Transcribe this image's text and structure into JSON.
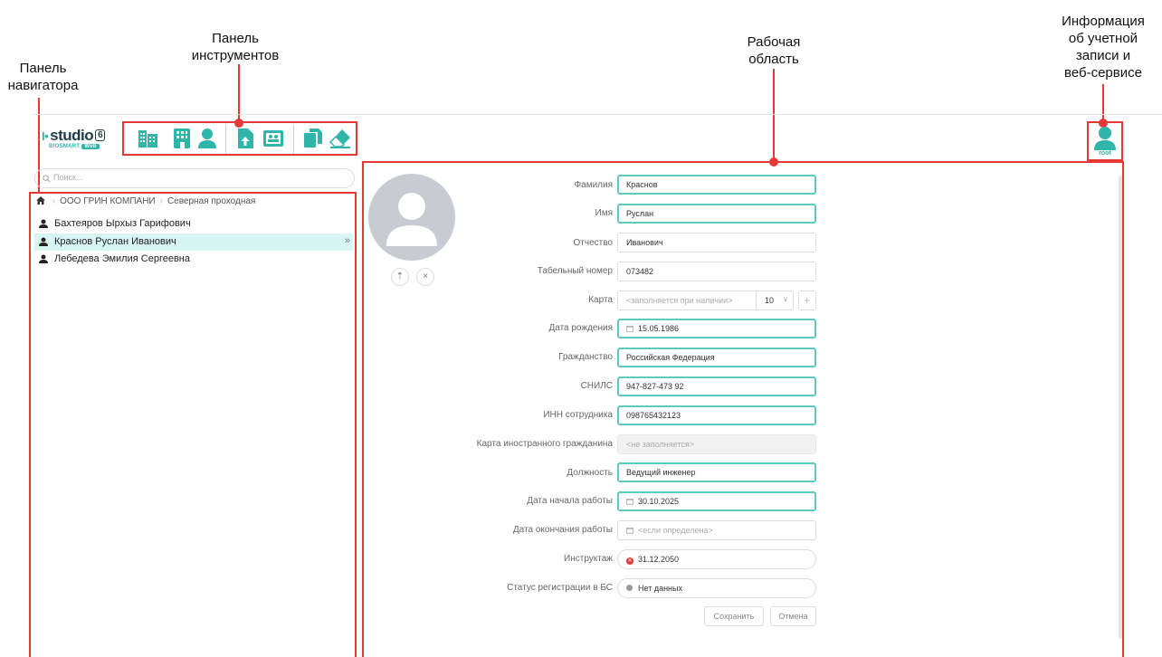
{
  "annotations": {
    "navigator_line1": "Панель",
    "navigator_line2": "навигатора",
    "toolbar_line1": "Панель",
    "toolbar_line2": "инструментов",
    "workspace_line1": "Рабочая",
    "workspace_line2": "область",
    "account_line1": "Информация",
    "account_line2": "об учетной",
    "account_line3": "записи и",
    "account_line4": "веб-сервисе"
  },
  "app": {
    "logo_text": "studio",
    "logo_version": "6",
    "logo_sub": "BIOSMART",
    "logo_web": "Web"
  },
  "toolbar": {
    "icons": [
      "organization-icon",
      "building-icon",
      "person-icon",
      "upload-file-icon",
      "badge-icon",
      "copy-icon",
      "eraser-icon"
    ]
  },
  "account": {
    "user": "root"
  },
  "navigator": {
    "search_placeholder": "Поиск...",
    "breadcrumb": [
      "ООО ГРИН КОМПАНИ",
      "Северная проходная"
    ],
    "people": [
      {
        "name": "Бахтеяров Ырхыз Гарифович",
        "selected": false
      },
      {
        "name": "Краснов Руслан Иванович",
        "selected": true
      },
      {
        "name": "Лебедева Эмилия Сергеевна",
        "selected": false
      }
    ]
  },
  "form": {
    "photo_upload_icon": "upload-icon",
    "photo_remove_icon": "close-icon",
    "fields": {
      "surname": {
        "label": "Фамилия",
        "value": "Краснов"
      },
      "name": {
        "label": "Имя",
        "value": "Руслан"
      },
      "patronymic": {
        "label": "Отчество",
        "value": "Иванович"
      },
      "tabnum": {
        "label": "Табельный номер",
        "value": "073482"
      },
      "card": {
        "label": "Карта",
        "placeholder": "<заполняется при наличии>",
        "format": "10"
      },
      "birth": {
        "label": "Дата рождения",
        "value": "15.05.1986"
      },
      "citizenship": {
        "label": "Гражданство",
        "value": "Российская Федерация"
      },
      "snils": {
        "label": "СНИЛС",
        "value": "947-827-473 92"
      },
      "inn": {
        "label": "ИНН сотрудника",
        "value": "098765432123"
      },
      "foreign_card": {
        "label": "Карта иностранного гражданина",
        "value": "<не заполняется>"
      },
      "position": {
        "label": "Должность",
        "value": "Ведущий инженер"
      },
      "start": {
        "label": "Дата начала работы",
        "value": "30.10.2025"
      },
      "end": {
        "label": "Дата окончания работы",
        "placeholder": "<если определена>"
      },
      "briefing": {
        "label": "Инструктаж",
        "value": "31.12.2050",
        "status_color": "#e53935"
      },
      "bio_status": {
        "label": "Статус регистрации в БС",
        "value": "Нет данных",
        "status_color": "#999999"
      }
    },
    "save_label": "Сохранить",
    "cancel_label": "Отмена"
  },
  "colors": {
    "accent": "#2fb5aa",
    "highlight": "#e53935"
  }
}
